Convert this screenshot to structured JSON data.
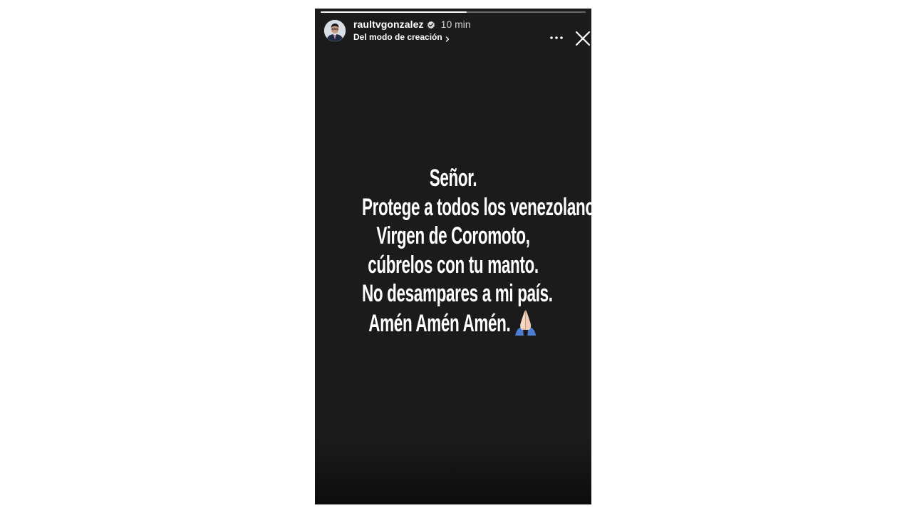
{
  "story": {
    "progress_fraction": 0.55,
    "username": "raultvgonzalez",
    "verified": true,
    "time_ago": "10 min",
    "subtitle": "Del modo de creación",
    "icons": [
      "verified-badge-icon",
      "chevron-right-icon",
      "more-options-icon",
      "close-icon",
      "praying-hands-icon"
    ],
    "message_lines": [
      "Señor.",
      "Protege a todos los venezolanos",
      "Virgen de Coromoto,",
      "cúbrelos con tu manto.",
      "No desampares a mi país.",
      "Amén Amén Amén."
    ],
    "colors": {
      "background": "#1b1b1b",
      "text": "#ffffff",
      "page": "#ffffff"
    }
  }
}
